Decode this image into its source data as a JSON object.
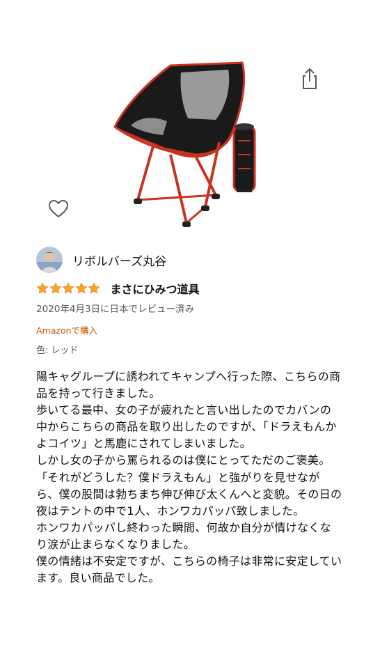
{
  "product": {
    "icons": {
      "share": "share-icon",
      "wishlist": "heart-outline-icon"
    },
    "colors": {
      "chair_frame": "#c8321e",
      "chair_fabric": "#1a1a1a",
      "chair_mesh": "#9a9a9a"
    }
  },
  "review": {
    "reviewer_name": "リボルバーズ丸谷",
    "rating": 5,
    "rating_max": 5,
    "title": "まさにひみつ道具",
    "date": "2020年4月3日に日本でレビュー済み",
    "badge_latin": "Amazon",
    "badge_jp": "で購入",
    "variant": "色: レッド",
    "body": [
      "陽キャグループに誘われてキャンプへ行った際、こちらの商品を持って行きました。",
      "歩いてる最中、女の子が疲れたと言い出したのでカバンの中からこちらの商品を取り出したのですが、「ドラえもんかよコイツ」と馬鹿にされてしまいました。",
      "しかし女の子から罵られるのは僕にとってただのご褒美。「それがどうした？僕ドラえもん」と強がりを見せながら、僕の股間は勃ちまち伸び伸び太くんへと変貌。その日の夜はテントの中で1人、ホンワカパッパ致しました。",
      "ホンワカパッパし終わった瞬間、何故か自分が情けなくなり涙が止まらなくなりました。",
      "僕の情緒は不安定ですが、こちらの椅子は非常に安定しています。良い商品でした。"
    ],
    "colors": {
      "star": "#ffa41c",
      "badge": "#c45500",
      "secondary_text": "#565959"
    }
  }
}
